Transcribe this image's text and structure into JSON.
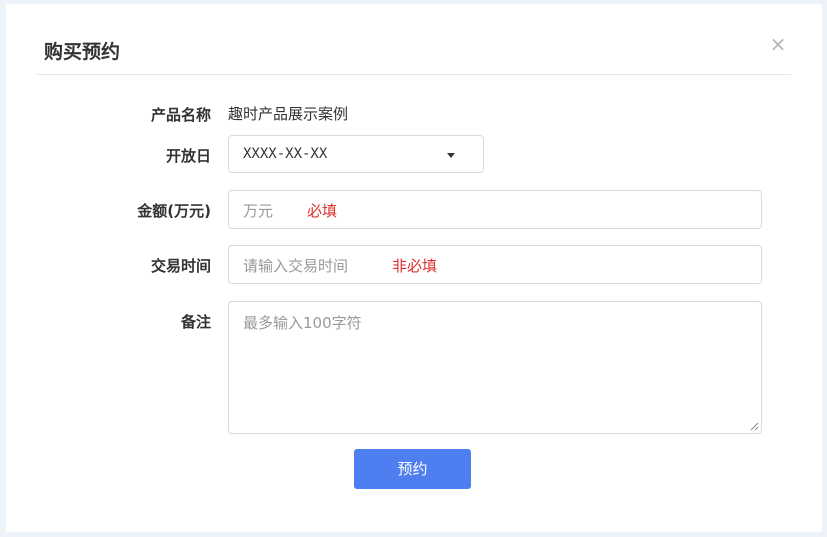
{
  "dialog": {
    "title": "购买预约",
    "close_icon": "×"
  },
  "form": {
    "product_name": {
      "label": "产品名称",
      "value": "趣时产品展示案例"
    },
    "open_date": {
      "label": "开放日",
      "selected": "XXXX-XX-XX"
    },
    "amount": {
      "label": "金额(万元)",
      "placeholder": "万元",
      "hint": "必填"
    },
    "trade_time": {
      "label": "交易时间",
      "placeholder": "请输入交易时间",
      "hint": "非必填"
    },
    "remark": {
      "label": "备注",
      "placeholder": "最多输入100字符"
    }
  },
  "buttons": {
    "submit_label": "预约"
  },
  "icons": {
    "close": "close-icon",
    "dropdown": "caret-down-icon",
    "resize": "resize-handle-icon"
  },
  "colors": {
    "primary": "#4f7ef0",
    "required_hint": "#e0302e",
    "background": "#eef3fa"
  }
}
